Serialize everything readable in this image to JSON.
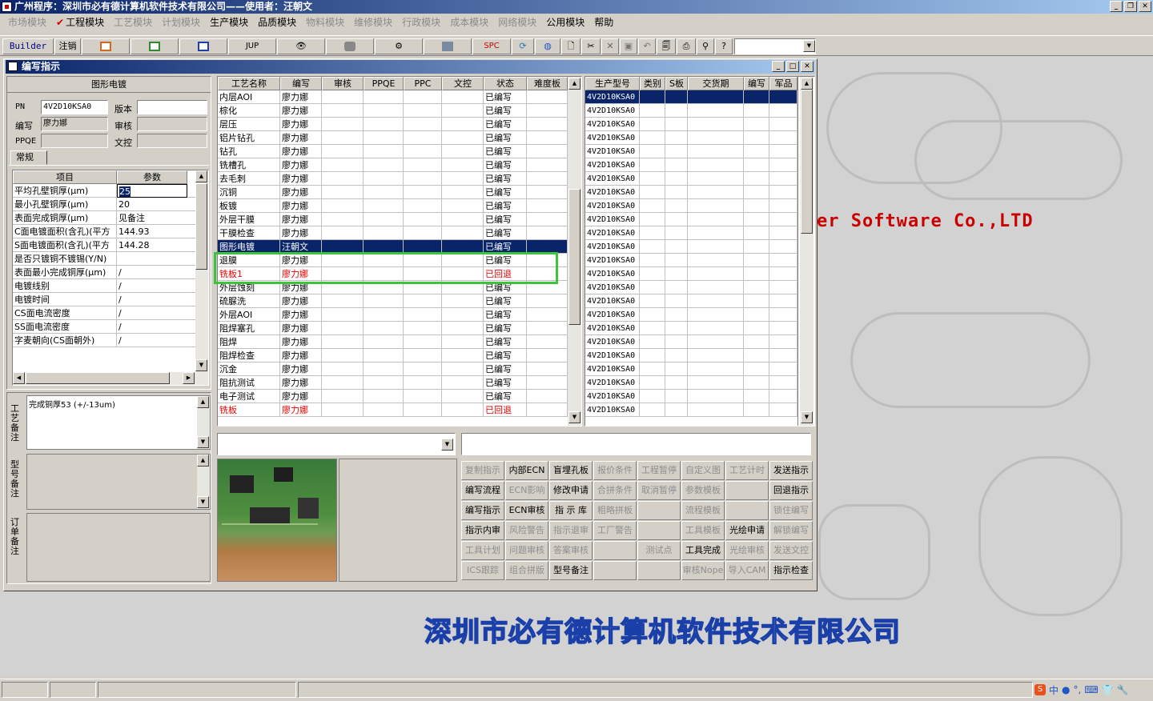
{
  "app": {
    "title": "广州程序：深圳市必有德计算机软件技术有限公司——使用者：汪朝文"
  },
  "menu": [
    {
      "label": "市场模块",
      "enabled": false
    },
    {
      "label": "工程模块",
      "enabled": true,
      "checked": true
    },
    {
      "label": "工艺模块",
      "enabled": false
    },
    {
      "label": "计划模块",
      "enabled": false
    },
    {
      "label": "生产模块",
      "enabled": true
    },
    {
      "label": "品质模块",
      "enabled": true
    },
    {
      "label": "物料模块",
      "enabled": false
    },
    {
      "label": "维修模块",
      "enabled": false
    },
    {
      "label": "行政模块",
      "enabled": false
    },
    {
      "label": "成本模块",
      "enabled": false
    },
    {
      "label": "网络模块",
      "enabled": false
    },
    {
      "label": "公用模块",
      "enabled": true
    },
    {
      "label": "帮助",
      "enabled": true
    }
  ],
  "toolbar": {
    "builder": "Builder",
    "logout": "注销",
    "jup": "JUP",
    "spc": "SPC"
  },
  "child": {
    "title": "编写指示"
  },
  "left": {
    "section_title": "图形电镀",
    "pn_label": "PN",
    "pn_value": "4V2D10KSA0",
    "version_label": "版本",
    "version_value": "",
    "author_label": "编写",
    "author_value": "廖力娜",
    "review_label": "审核",
    "review_value": "",
    "ppqe_label": "PPQE",
    "ppqe_value": "",
    "control_label": "文控",
    "control_value": "",
    "tab_label": "常规",
    "param_headers": [
      "项目",
      "参数"
    ],
    "params": [
      {
        "item": "平均孔壁铜厚(μm)",
        "value": "25"
      },
      {
        "item": "最小孔壁铜厚(μm)",
        "value": "20"
      },
      {
        "item": "表面完成铜厚(μm)",
        "value": "见备注"
      },
      {
        "item": "C面电镀面积(含孔)(平方",
        "value": "144.93"
      },
      {
        "item": "S面电镀面积(含孔)(平方",
        "value": "144.28"
      },
      {
        "item": "是否只镀铜不镀锡(Y/N)",
        "value": ""
      },
      {
        "item": "表面最小完成铜厚(μm)",
        "value": "/"
      },
      {
        "item": "电镀线别",
        "value": "/"
      },
      {
        "item": "电镀时间",
        "value": "/"
      },
      {
        "item": "CS面电流密度",
        "value": "/"
      },
      {
        "item": "SS面电流密度",
        "value": "/"
      },
      {
        "item": "字麦朝向(CS面朝外)",
        "value": "/"
      }
    ],
    "note_labels": [
      "工艺备注",
      "型号备注",
      "订单备注"
    ],
    "process_note": "完成铜厚53 (+/-13um)"
  },
  "process_grid": {
    "headers": [
      "工艺名称",
      "编写",
      "审核",
      "PPQE",
      "PPC",
      "文控",
      "状态",
      "难度板"
    ],
    "rows": [
      {
        "name": "内层AOI",
        "author": "廖力娜",
        "status": "已编写",
        "style": ""
      },
      {
        "name": "棕化",
        "author": "廖力娜",
        "status": "已编写",
        "style": ""
      },
      {
        "name": "层压",
        "author": "廖力娜",
        "status": "已编写",
        "style": ""
      },
      {
        "name": "铝片钻孔",
        "author": "廖力娜",
        "status": "已编写",
        "style": ""
      },
      {
        "name": "钻孔",
        "author": "廖力娜",
        "status": "已编写",
        "style": ""
      },
      {
        "name": "铣槽孔",
        "author": "廖力娜",
        "status": "已编写",
        "style": ""
      },
      {
        "name": "去毛刺",
        "author": "廖力娜",
        "status": "已编写",
        "style": ""
      },
      {
        "name": "沉铜",
        "author": "廖力娜",
        "status": "已编写",
        "style": ""
      },
      {
        "name": "板镀",
        "author": "廖力娜",
        "status": "已编写",
        "style": ""
      },
      {
        "name": "外层干膜",
        "author": "廖力娜",
        "status": "已编写",
        "style": ""
      },
      {
        "name": "干膜检查",
        "author": "廖力娜",
        "status": "已编写",
        "style": ""
      },
      {
        "name": "图形电镀",
        "author": "汪朝文",
        "status": "已编写",
        "style": "sel"
      },
      {
        "name": "退膜",
        "author": "廖力娜",
        "status": "已编写",
        "style": ""
      },
      {
        "name": "铣板1",
        "author": "廖力娜",
        "status": "已回退",
        "style": "red"
      },
      {
        "name": "外层蚀刻",
        "author": "廖力娜",
        "status": "已编写",
        "style": ""
      },
      {
        "name": "硫脲洗",
        "author": "廖力娜",
        "status": "已编写",
        "style": ""
      },
      {
        "name": "外层AOI",
        "author": "廖力娜",
        "status": "已编写",
        "style": ""
      },
      {
        "name": "阻焊塞孔",
        "author": "廖力娜",
        "status": "已编写",
        "style": ""
      },
      {
        "name": "阻焊",
        "author": "廖力娜",
        "status": "已编写",
        "style": ""
      },
      {
        "name": "阻焊检查",
        "author": "廖力娜",
        "status": "已编写",
        "style": ""
      },
      {
        "name": "沉金",
        "author": "廖力娜",
        "status": "已编写",
        "style": ""
      },
      {
        "name": "阻抗测试",
        "author": "廖力娜",
        "status": "已编写",
        "style": ""
      },
      {
        "name": "电子测试",
        "author": "廖力娜",
        "status": "已编写",
        "style": ""
      },
      {
        "name": "铣板",
        "author": "廖力娜",
        "status": "已回退",
        "style": "red"
      }
    ]
  },
  "model_grid": {
    "headers": [
      "生产型号",
      "类别",
      "S板",
      "交货期",
      "编写",
      "军品"
    ],
    "rows": [
      "4V2D10KSA0",
      "4V2D10KSA0",
      "4V2D10KSA0",
      "4V2D10KSA0",
      "4V2D10KSA0",
      "4V2D10KSA0",
      "4V2D10KSA0",
      "4V2D10KSA0",
      "4V2D10KSA0",
      "4V2D10KSA0",
      "4V2D10KSA0",
      "4V2D10KSA0",
      "4V2D10KSA0",
      "4V2D10KSA0",
      "4V2D10KSA0",
      "4V2D10KSA0",
      "4V2D10KSA0",
      "4V2D10KSA0",
      "4V2D10KSA0",
      "4V2D10KSA0",
      "4V2D10KSA0",
      "4V2D10KSA0",
      "4V2D10KSA0",
      "4V2D10KSA0"
    ]
  },
  "buttons": [
    [
      {
        "l": "复制指示",
        "e": false
      },
      {
        "l": "内部ECN",
        "e": true
      },
      {
        "l": "盲埋孔板",
        "e": true
      },
      {
        "l": "报价条件",
        "e": false
      },
      {
        "l": "工程暂停",
        "e": false
      },
      {
        "l": "自定义图",
        "e": false
      },
      {
        "l": "工艺计时",
        "e": false
      },
      {
        "l": "发送指示",
        "e": true
      }
    ],
    [
      {
        "l": "编写流程",
        "e": true
      },
      {
        "l": "ECN影响",
        "e": false
      },
      {
        "l": "修改申请",
        "e": true
      },
      {
        "l": "合拼条件",
        "e": false
      },
      {
        "l": "取消暂停",
        "e": false
      },
      {
        "l": "参数模板",
        "e": false
      },
      {
        "l": "",
        "e": false
      },
      {
        "l": "回退指示",
        "e": true
      }
    ],
    [
      {
        "l": "编写指示",
        "e": true
      },
      {
        "l": "ECN审核",
        "e": true
      },
      {
        "l": "指 示 库",
        "e": true
      },
      {
        "l": "粗略拼板",
        "e": false
      },
      {
        "l": "",
        "e": false
      },
      {
        "l": "流程模板",
        "e": false
      },
      {
        "l": "",
        "e": false
      },
      {
        "l": "锁住编写",
        "e": false
      }
    ],
    [
      {
        "l": "指示内审",
        "e": true
      },
      {
        "l": "风险警告",
        "e": false
      },
      {
        "l": "指示退审",
        "e": false
      },
      {
        "l": "工厂警告",
        "e": false
      },
      {
        "l": "",
        "e": false
      },
      {
        "l": "工具模板",
        "e": false
      },
      {
        "l": "光绘申请",
        "e": true
      },
      {
        "l": "解锁编写",
        "e": false
      }
    ],
    [
      {
        "l": "工具计划",
        "e": false
      },
      {
        "l": "问题审核",
        "e": false
      },
      {
        "l": "答案审核",
        "e": false
      },
      {
        "l": "",
        "e": false
      },
      {
        "l": "测试点",
        "e": false
      },
      {
        "l": "工具完成",
        "e": true
      },
      {
        "l": "光绘审核",
        "e": false
      },
      {
        "l": "发送文控",
        "e": false
      }
    ],
    [
      {
        "l": "ICS跟踪",
        "e": false
      },
      {
        "l": "组合拼版",
        "e": false
      },
      {
        "l": "型号备注",
        "e": true
      },
      {
        "l": "",
        "e": false
      },
      {
        "l": "",
        "e": false
      },
      {
        "l": "审核Nope",
        "e": false
      },
      {
        "l": "导入CAM",
        "e": false
      },
      {
        "l": "指示检查",
        "e": true
      }
    ]
  ],
  "background": {
    "software_text": "er Software Co.,LTD",
    "company_name": "深圳市必有德计算机软件技术有限公司"
  },
  "tray": {
    "ime": "中"
  },
  "colors": {
    "title_start": "#0a246a",
    "title_end": "#a6caf0",
    "selected": "#0a246a",
    "returned": "#e00000",
    "highlight_box": "#3cc43c"
  }
}
